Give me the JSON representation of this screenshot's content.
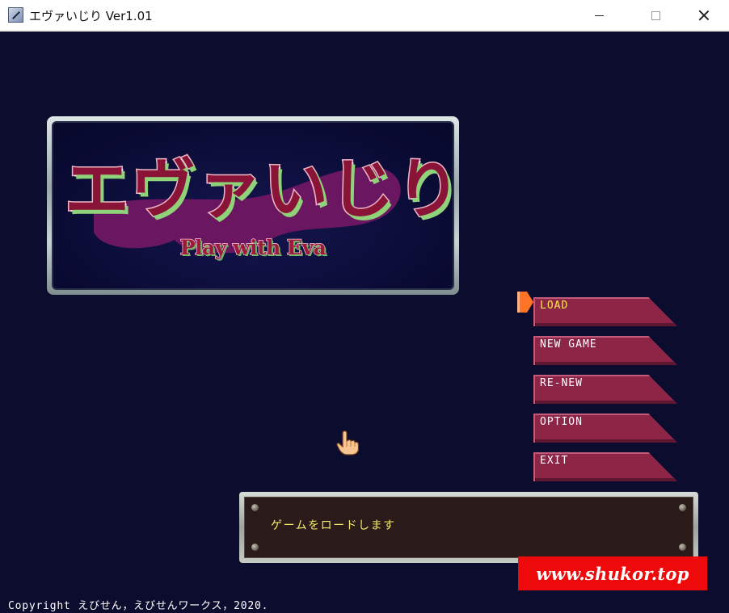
{
  "window": {
    "title": "エヴァいじり Ver1.01",
    "controls": [
      "minimize",
      "maximize",
      "close"
    ]
  },
  "logo": {
    "title": "エヴァいじり",
    "subtitle": "Play with Eva"
  },
  "menu": {
    "selected_index": 0,
    "items": [
      {
        "label": "LOAD"
      },
      {
        "label": "NEW GAME"
      },
      {
        "label": "RE-NEW"
      },
      {
        "label": "OPTION"
      },
      {
        "label": "EXIT"
      }
    ]
  },
  "message": {
    "text": "ゲームをロードします"
  },
  "watermark": {
    "text": "www.shukor.top"
  },
  "copyright": "Copyright えびせん，えびせんワークス，2020.",
  "colors": {
    "background": "#0c0c2e",
    "menu_fill": "#8d2547",
    "menu_selected_text": "#ffe84a",
    "cursor_accent": "#ff7326",
    "message_text": "#f4ec6a",
    "watermark_bg": "#ee0a0a"
  },
  "icons": {
    "app": "app-icon",
    "menu_cursor": "arrow-cursor-icon",
    "pointer": "hand-pointer-icon"
  }
}
